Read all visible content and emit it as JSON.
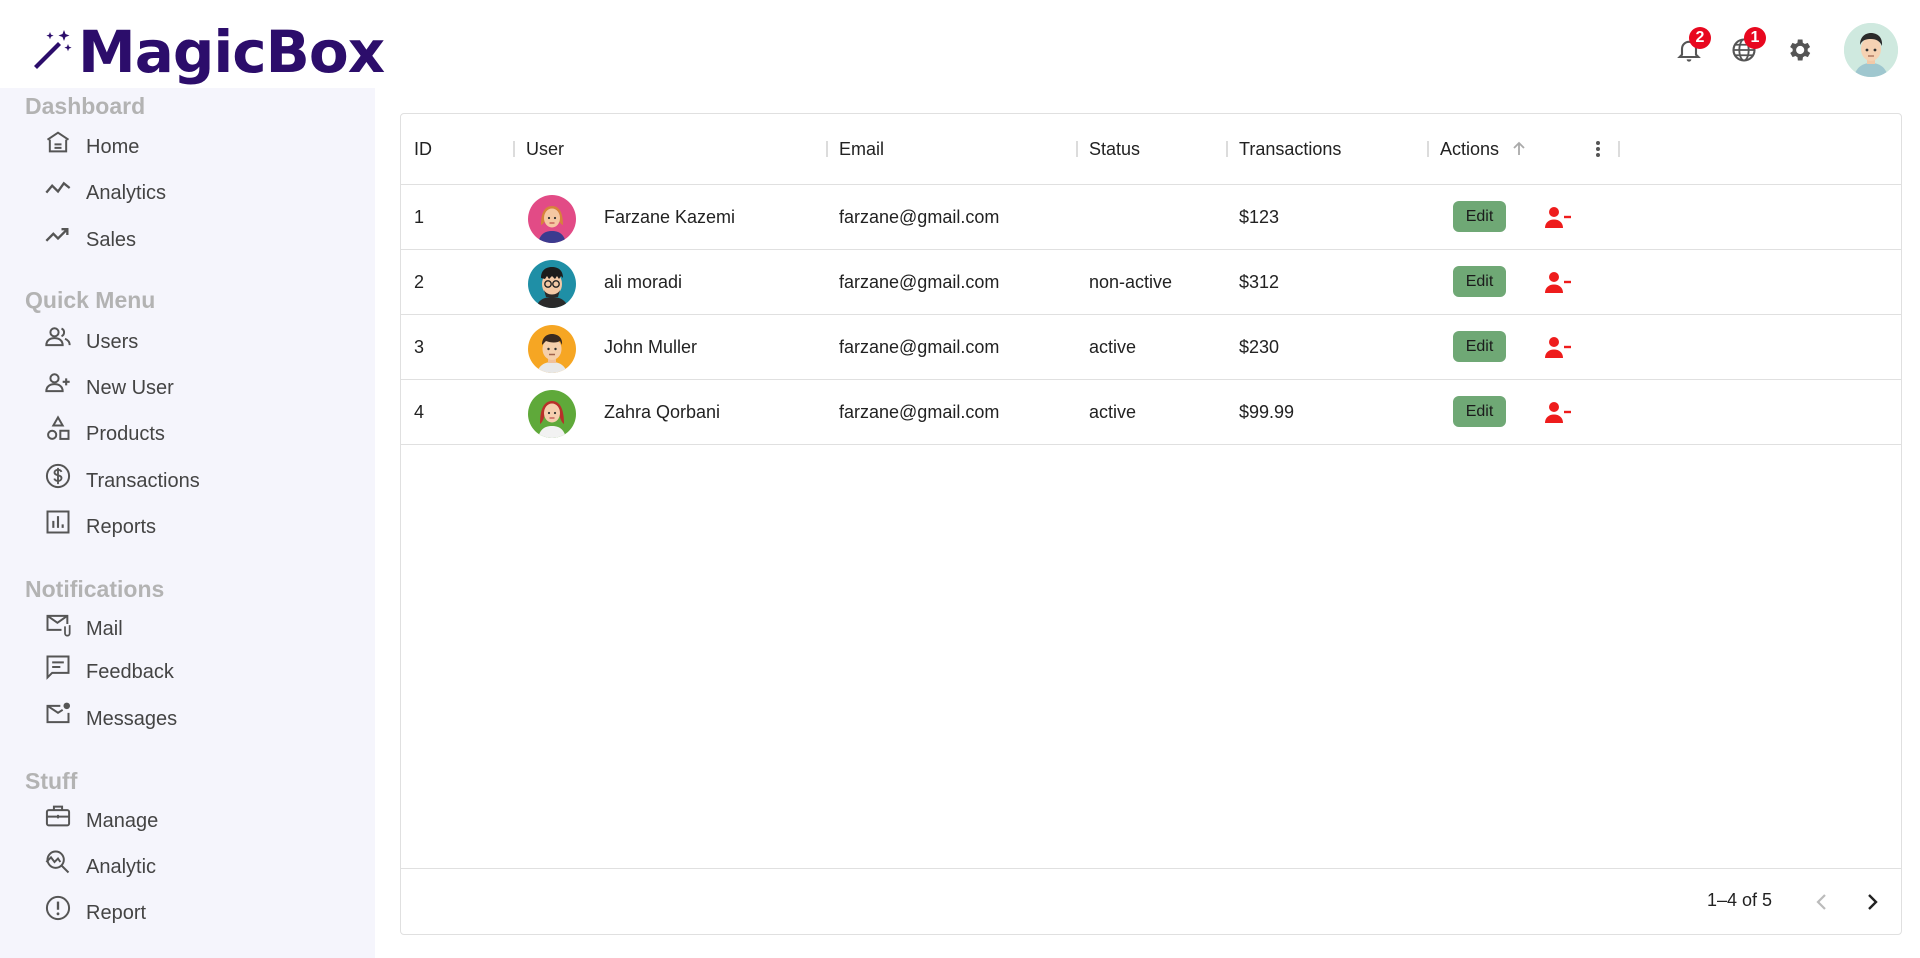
{
  "app": {
    "name": "MagicBox"
  },
  "header": {
    "notifications_badge": "2",
    "language_badge": "1"
  },
  "sidebar": {
    "sections": [
      {
        "title": "Dashboard",
        "items": [
          {
            "label": "Home",
            "icon": "home-icon"
          },
          {
            "label": "Analytics",
            "icon": "timeline-icon"
          },
          {
            "label": "Sales",
            "icon": "trending-up-icon"
          }
        ]
      },
      {
        "title": "Quick Menu",
        "items": [
          {
            "label": "Users",
            "icon": "users-icon"
          },
          {
            "label": "New User",
            "icon": "add-user-icon"
          },
          {
            "label": "Products",
            "icon": "shapes-icon"
          },
          {
            "label": "Transactions",
            "icon": "dollar-icon"
          },
          {
            "label": "Reports",
            "icon": "bar-chart-icon"
          }
        ]
      },
      {
        "title": "Notifications",
        "items": [
          {
            "label": "Mail",
            "icon": "mail-attach-icon"
          },
          {
            "label": "Feedback",
            "icon": "feedback-icon"
          },
          {
            "label": "Messages",
            "icon": "unread-mail-icon"
          }
        ]
      },
      {
        "title": "Stuff",
        "items": [
          {
            "label": "Manage",
            "icon": "work-icon"
          },
          {
            "label": "Analytic",
            "icon": "query-stats-icon"
          },
          {
            "label": "Report",
            "icon": "report-icon"
          }
        ]
      }
    ]
  },
  "table": {
    "columns": [
      "ID",
      "User",
      "Email",
      "Status",
      "Transactions",
      "Actions"
    ],
    "rows": [
      {
        "id": "1",
        "user": "Farzane Kazemi",
        "email": "farzane@gmail.com",
        "status": "",
        "transactions": "$123",
        "action": "Edit",
        "avatar_bg": "#e24b86"
      },
      {
        "id": "2",
        "user": "ali moradi",
        "email": "farzane@gmail.com",
        "status": "non-active",
        "transactions": "$312",
        "action": "Edit",
        "avatar_bg": "#1f8fa6"
      },
      {
        "id": "3",
        "user": "John Muller",
        "email": "farzane@gmail.com",
        "status": "active",
        "transactions": "$230",
        "action": "Edit",
        "avatar_bg": "#f6a623"
      },
      {
        "id": "4",
        "user": "Zahra Qorbani",
        "email": "farzane@gmail.com",
        "status": "active",
        "transactions": "$99.99",
        "action": "Edit",
        "avatar_bg": "#5fa93a"
      }
    ],
    "pagination": "1–4 of 5"
  },
  "colors": {
    "brand": "#2c0d6b",
    "edit_button": "#6fa875",
    "delete": "#ee1c1c",
    "badge": "#e8081f",
    "sidebar_bg": "#f5f5fc"
  }
}
